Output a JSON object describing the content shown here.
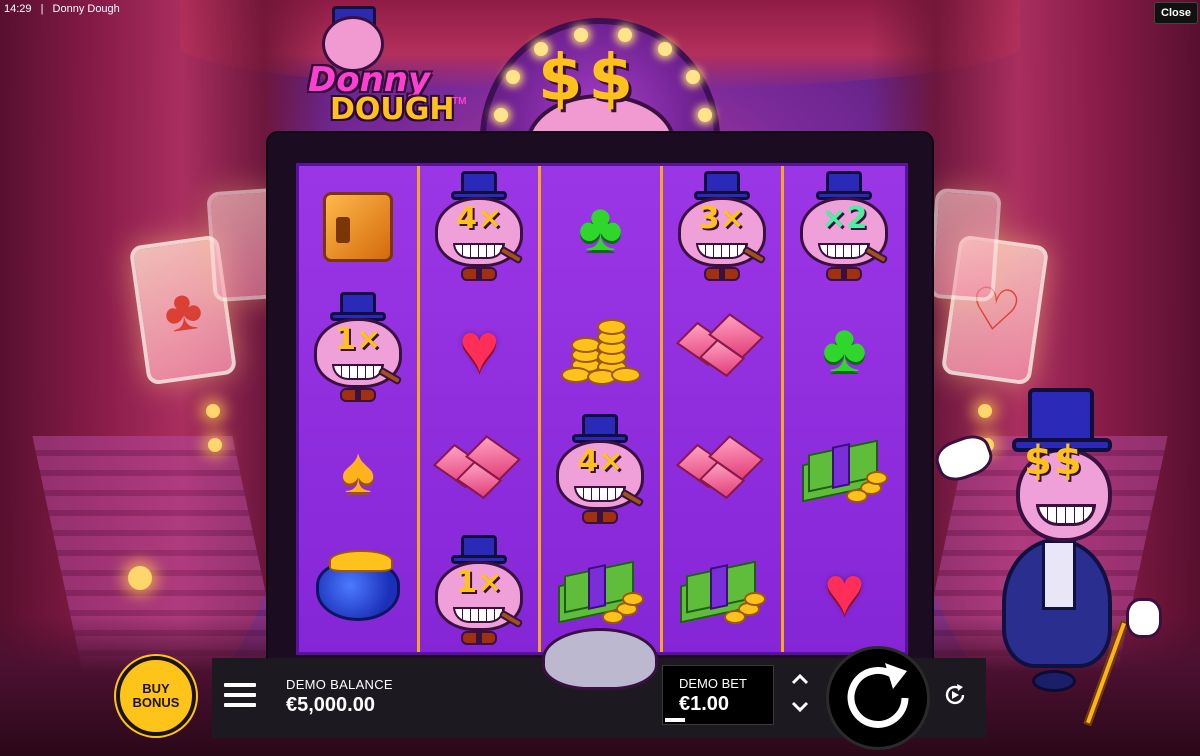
{
  "status_bar": {
    "time": "14:29",
    "separator": "|",
    "window_title": "Donny Dough"
  },
  "close_button": {
    "label": "Close"
  },
  "logo": {
    "line1": "Donny",
    "line2": "DOUGH",
    "trademark": "TM"
  },
  "marquee": {
    "text": "$$"
  },
  "reels": [
    [
      {
        "symbol": "safe",
        "icon": "vault-safe-icon"
      },
      {
        "symbol": "donny",
        "multiplier": "1×"
      },
      {
        "symbol": "spade",
        "icon": "spade-icon"
      },
      {
        "symbol": "purse",
        "icon": "coin-purse-icon"
      }
    ],
    [
      {
        "symbol": "donny",
        "multiplier": "4×"
      },
      {
        "symbol": "heart",
        "icon": "heart-icon"
      },
      {
        "symbol": "gem",
        "icon": "gems-icon"
      },
      {
        "symbol": "donny",
        "multiplier": "1×"
      }
    ],
    [
      {
        "symbol": "club",
        "icon": "club-icon"
      },
      {
        "symbol": "coins",
        "icon": "coin-stack-icon"
      },
      {
        "symbol": "donny",
        "multiplier": "4×"
      },
      {
        "symbol": "cash",
        "icon": "cash-stack-icon"
      }
    ],
    [
      {
        "symbol": "donny",
        "multiplier": "3×"
      },
      {
        "symbol": "gem",
        "icon": "gems-icon"
      },
      {
        "symbol": "gem",
        "icon": "gems-icon"
      },
      {
        "symbol": "cash",
        "icon": "cash-stack-icon"
      }
    ],
    [
      {
        "symbol": "donny",
        "multiplier": "×2",
        "style": "green"
      },
      {
        "symbol": "club",
        "icon": "club-icon"
      },
      {
        "symbol": "cash",
        "icon": "cash-stack-icon"
      },
      {
        "symbol": "heart",
        "icon": "heart-icon"
      }
    ]
  ],
  "buy_bonus": {
    "label": "BUY BONUS"
  },
  "balance": {
    "label": "DEMO BALANCE",
    "value": "€5,000.00"
  },
  "bet": {
    "label": "DEMO BET",
    "value": "€1.00",
    "increase_icon": "chevron-up-icon",
    "decrease_icon": "chevron-down-icon"
  },
  "controls": {
    "menu_icon": "hamburger-menu-icon",
    "spin_icon": "spin-arrow-icon",
    "autoplay_icon": "autoplay-icon"
  },
  "colors": {
    "reel_background": "#8e2bd8",
    "reel_divider": "#f5a623",
    "bottom_bar": "#1c1a20",
    "buy_bonus": "#ffc419",
    "accent_gold": "#ffc21d"
  }
}
